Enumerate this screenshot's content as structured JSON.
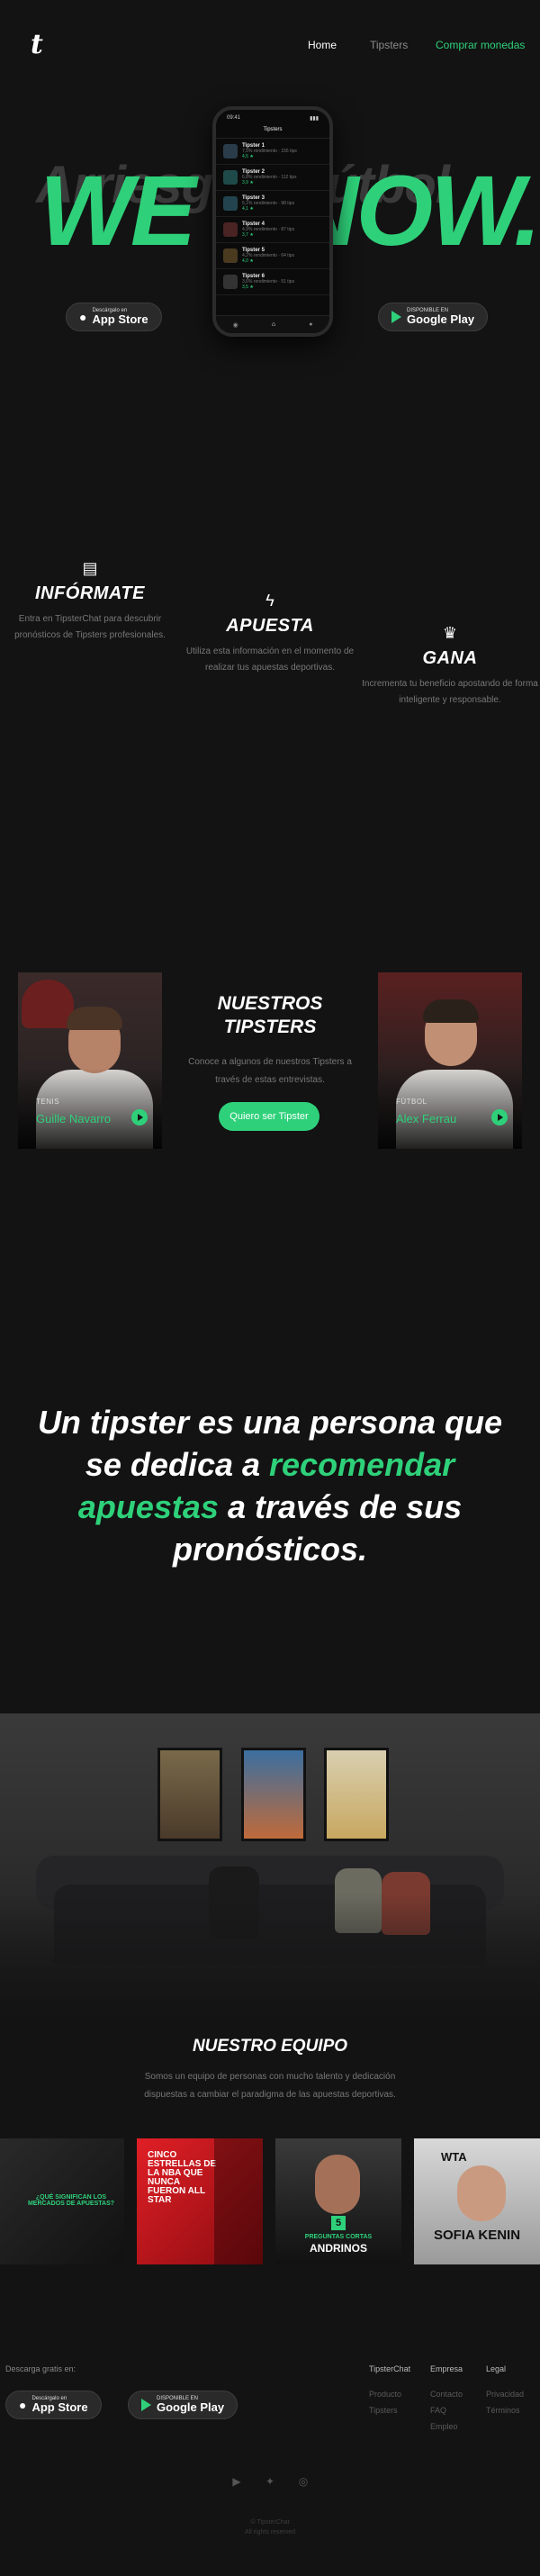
{
  "brand": {
    "logo": "t",
    "accent": "#2ed17a"
  },
  "nav": {
    "home": "Home",
    "tipsters": "Tipsters",
    "buy": "Comprar monedas"
  },
  "hero": {
    "ghost_text": "Arriesga el fútbol",
    "title": "WE KNOW.",
    "phone": {
      "time": "09:41",
      "header": "Tipsters",
      "rows": [
        {
          "name": "Tipster 1",
          "meta": "7,5% rendimiento · 155 tips",
          "picks": "4,5 ★"
        },
        {
          "name": "Tipster 2",
          "meta": "6,8% rendimiento · 112 tips",
          "picks": "3,9 ★"
        },
        {
          "name": "Tipster 3",
          "meta": "5,1% rendimiento · 98 tips",
          "picks": "4,1 ★"
        },
        {
          "name": "Tipster 4",
          "meta": "4,9% rendimiento · 87 tips",
          "picks": "3,7 ★"
        },
        {
          "name": "Tipster 5",
          "meta": "4,2% rendimiento · 64 tips",
          "picks": "4,0 ★"
        },
        {
          "name": "Tipster 6",
          "meta": "3,6% rendimiento · 51 tips",
          "picks": "3,5 ★"
        }
      ]
    }
  },
  "stores": {
    "appstore_small": "Descárgalo en",
    "appstore_big": "App Store",
    "gplay_small": "DISPONIBLE EN",
    "gplay_big": "Google Play"
  },
  "features": [
    {
      "icon": "document-icon",
      "title": "INFÓRMATE",
      "text": "Entra en TipsterChat para descubrir pronósticos de Tipsters profesionales."
    },
    {
      "icon": "bolt-icon",
      "title": "APUESTA",
      "text": "Utiliza esta información en el momento de realizar tus apuestas deportivas."
    },
    {
      "icon": "crown-icon",
      "title": "GANA",
      "text": "Incrementa tu beneficio apostando de forma inteligente y responsable."
    }
  ],
  "tipsters": {
    "title": "NUESTROS TIPSTERS",
    "desc": "Conoce a algunos de nuestros Tipsters a través de estas entrevistas.",
    "cta": "Quiero ser Tipster",
    "cards": [
      {
        "category": "TENIS",
        "name": "Guille Navarro"
      },
      {
        "category": "FÚTBOL",
        "name": "Alex Ferrau"
      }
    ]
  },
  "quote": {
    "p1": "Un tipster es una persona que se dedica a ",
    "highlight": "recomendar apuestas",
    "p2": " a través de sus pronósticos."
  },
  "team": {
    "title": "NUESTRO EQUIPO",
    "desc": "Somos un equipo de personas con mucho talento y dedicación dispuestas a cambiar el paradigma de las apuestas deportivas.",
    "slides": [
      {
        "text": "¿QUÉ SIGNIFICAN LOS MERCADOS DE APUESTAS?"
      },
      {
        "text": "CINCO ESTRELLAS DE LA NBA QUE NUNCA FUERON ALL STAR"
      },
      {
        "badge": "5",
        "text": "PREGUNTAS CORTAS",
        "name": "ANDRINOS"
      },
      {
        "text": "SOFIA KENIN",
        "label": "WTA"
      }
    ]
  },
  "footer": {
    "download_label": "Descarga gratis en:",
    "columns": [
      {
        "title": "TipsterChat",
        "links": [
          "Producto",
          "Tipsters"
        ]
      },
      {
        "title": "Empresa",
        "links": [
          "Contacto",
          "FAQ",
          "Empleo"
        ]
      },
      {
        "title": "Legal",
        "links": [
          "Privacidad",
          "Términos"
        ]
      }
    ],
    "social": [
      "youtube-icon",
      "twitter-icon",
      "instagram-icon"
    ],
    "copyright": "© TipsterChat",
    "rights": "All rights reserved"
  }
}
